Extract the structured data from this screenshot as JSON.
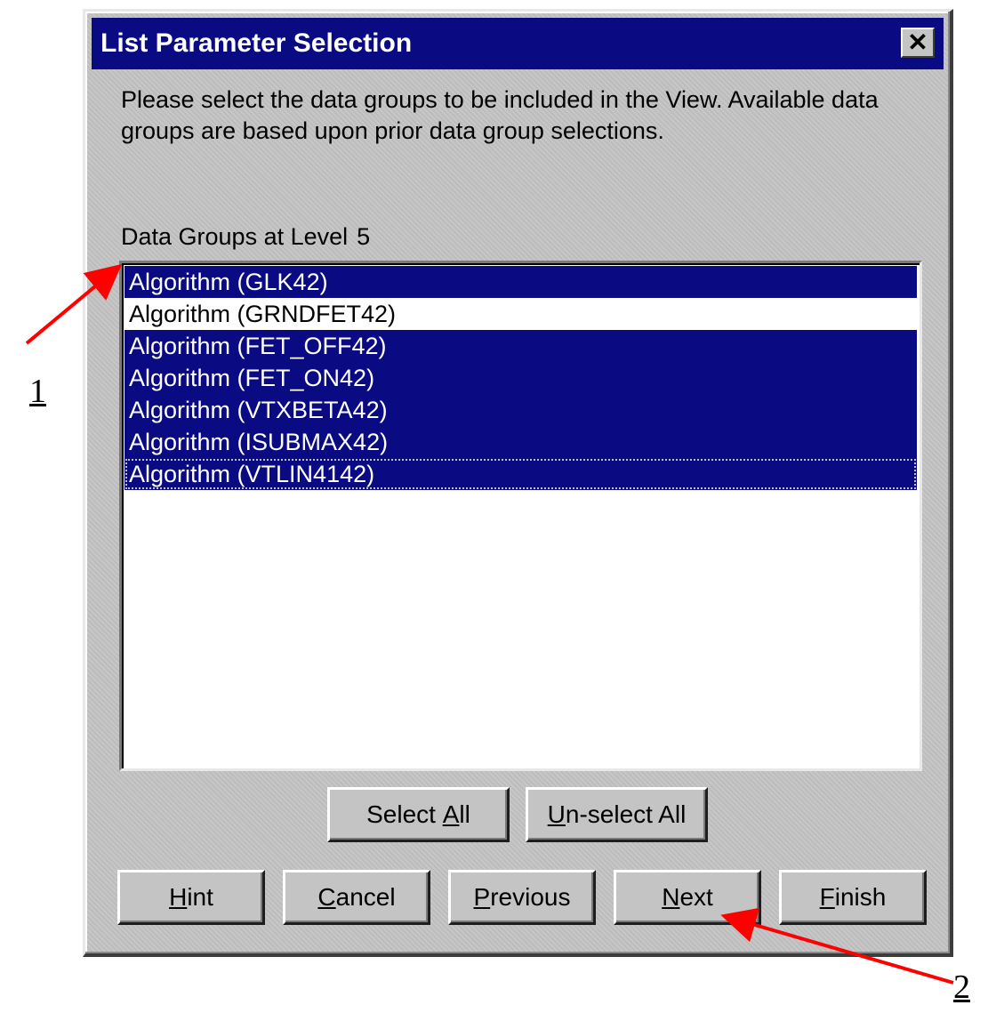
{
  "dialog": {
    "title": "List Parameter Selection",
    "close_glyph": "✕",
    "instruction": "Please select the data groups to be included in the View.  Available data groups are based upon prior data group selections.",
    "level_label": "Data Groups at Level",
    "level_number": "5"
  },
  "list": {
    "items": [
      {
        "label": "Algorithm (GLK42)",
        "selected": true
      },
      {
        "label": "Algorithm (GRNDFET42)",
        "selected": false
      },
      {
        "label": "Algorithm (FET_OFF42)",
        "selected": true
      },
      {
        "label": "Algorithm (FET_ON42)",
        "selected": true
      },
      {
        "label": "Algorithm (VTXBETA42)",
        "selected": true
      },
      {
        "label": "Algorithm (ISUBMAX42)",
        "selected": true
      },
      {
        "label": "Algorithm (VTLIN4142)",
        "selected": true
      }
    ]
  },
  "buttons": {
    "select_all": {
      "pre": "Select ",
      "key": "A",
      "post": "ll"
    },
    "unselect_all": {
      "pre": "",
      "key": "U",
      "post": "n-select All"
    },
    "hint": {
      "pre": "",
      "key": "H",
      "post": "int"
    },
    "cancel": {
      "pre": "",
      "key": "C",
      "post": "ancel"
    },
    "previous": {
      "pre": "",
      "key": "P",
      "post": "revious"
    },
    "next": {
      "pre": "",
      "key": "N",
      "post": "ext"
    },
    "finish": {
      "pre": "",
      "key": "F",
      "post": "inish"
    }
  },
  "callouts": {
    "one": "1",
    "two": "2"
  },
  "colors": {
    "title_bar": "#0a0a82",
    "selection": "#0a0a82",
    "arrow": "#ff0000",
    "dialog_face": "#c4c4c4"
  },
  "icons": {
    "close": "close-icon"
  }
}
